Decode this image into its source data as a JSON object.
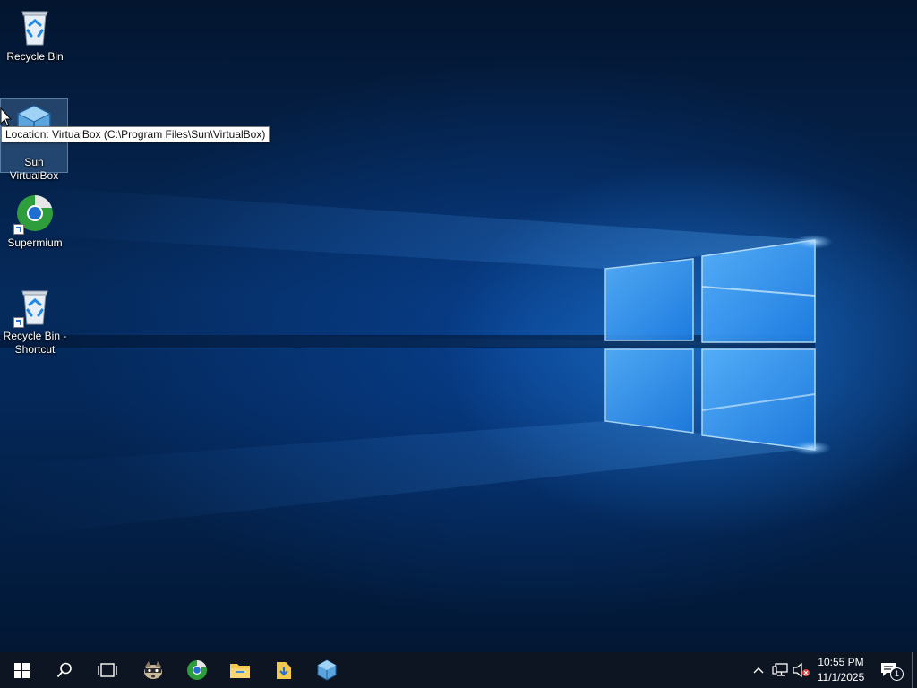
{
  "desktop": {
    "icons": [
      {
        "label": "Recycle Bin"
      },
      {
        "label": "Sun VirtualBox"
      },
      {
        "label": "Supermium"
      },
      {
        "label": "Recycle Bin - Shortcut"
      }
    ],
    "tooltip": "Location: VirtualBox (C:\\Program Files\\Sun\\VirtualBox)"
  },
  "taskbar": {
    "icons": [
      "windows-start-icon",
      "search-icon",
      "task-view-icon",
      "raccoon-app-icon",
      "supermium-icon",
      "file-explorer-icon",
      "downloads-folder-icon",
      "virtualbox-icon"
    ],
    "tray_icons": [
      "chevron-up-icon",
      "network-icon",
      "volume-muted-icon",
      "action-center-icon"
    ],
    "clock_time": "10:55 PM",
    "clock_date": "11/1/2025",
    "notification_count": "1"
  },
  "colors": {
    "taskbar": "#0c1521",
    "accent": "#2a8cf0"
  }
}
